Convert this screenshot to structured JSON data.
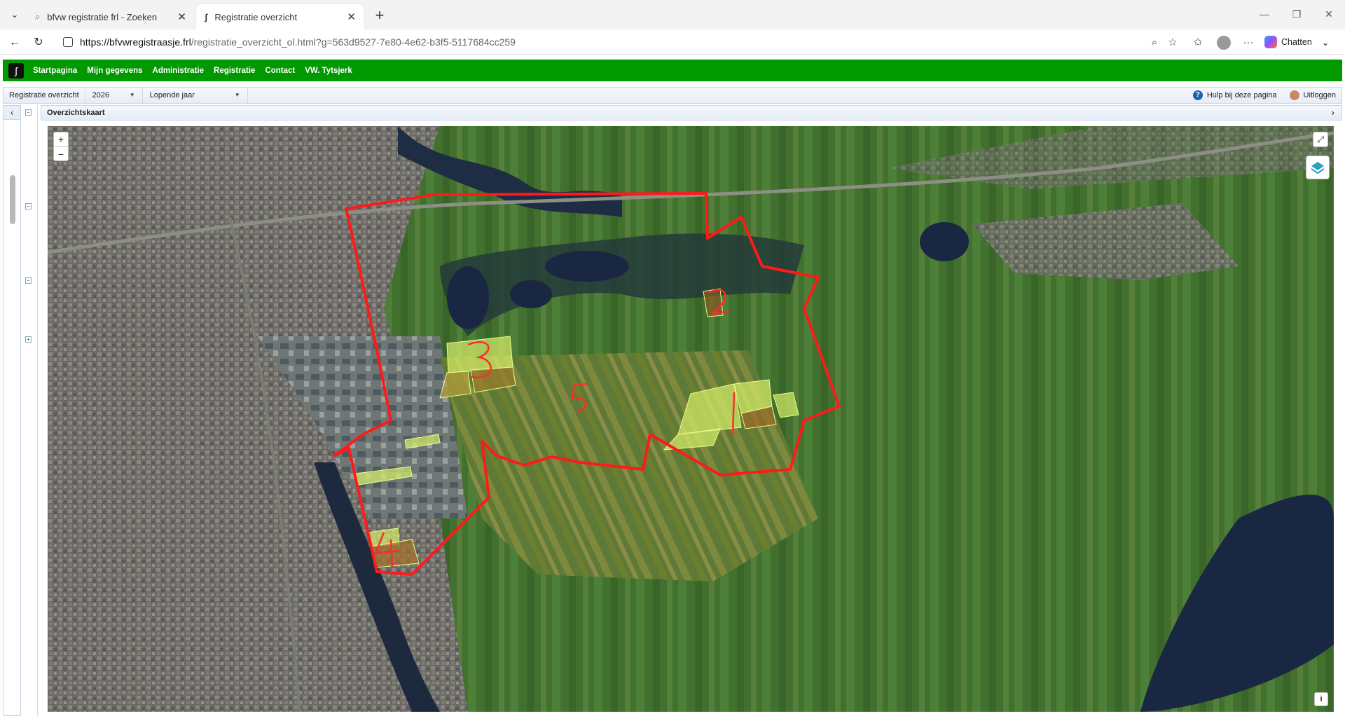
{
  "browser": {
    "tabs": [
      {
        "title": "bfvw registratie frl - Zoeken"
      },
      {
        "title": "Registratie overzicht"
      }
    ],
    "url_host": "https://bfvwregistraasje.frl",
    "url_rest": "/registratie_overzicht_ol.html?g=563d9527-7e80-4e62-b3f5-5117684cc259",
    "chat_label": "Chatten"
  },
  "app": {
    "menu": [
      "Startpagina",
      "Mijn gegevens",
      "Administratie",
      "Registratie",
      "Contact",
      "VW. Tytsjerk"
    ],
    "toolbar": {
      "page_label": "Registratie overzicht",
      "year_value": "2026",
      "period_value": "Lopende jaar",
      "help_label": "Hulp bij deze pagina",
      "logout_label": "Uitloggen"
    },
    "map_title": "Overzichtskaart"
  },
  "map": {
    "zoom_in": "+",
    "zoom_out": "−",
    "info": "i",
    "boundary_color": "#ff1a1a",
    "field_color": "#d7f06a",
    "annotation_labels": [
      "1",
      "2",
      "3",
      "4",
      "5"
    ]
  }
}
